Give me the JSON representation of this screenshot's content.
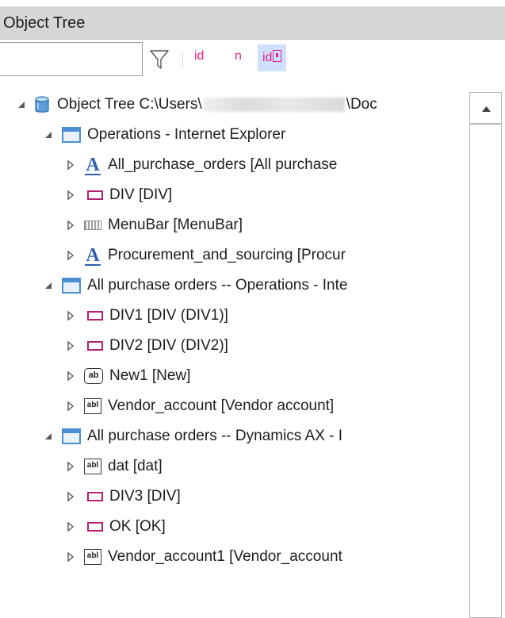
{
  "panel": {
    "title": "Object Tree"
  },
  "toolbar": {
    "search_value": "",
    "filter_icon": "filter-icon",
    "id_label": "id",
    "n_label": "n",
    "id_alt_label": "id"
  },
  "tree": {
    "root": {
      "label_start": "Object Tree C:\\Users\\",
      "label_end": "\\Doc"
    },
    "nodes": [
      {
        "label": "Operations - Internet Explorer",
        "icon": "window-icon"
      },
      {
        "label": "All_purchase_orders [All purchase",
        "icon": "anchor-a-icon"
      },
      {
        "label": "DIV [DIV]",
        "icon": "div-icon"
      },
      {
        "label": "MenuBar [MenuBar]",
        "icon": "menubar-icon"
      },
      {
        "label": "Procurement_and_sourcing [Procur",
        "icon": "anchor-a-icon"
      },
      {
        "label": "All purchase orders -- Operations - Inte",
        "icon": "window-icon"
      },
      {
        "label": "DIV1 [DIV (DIV1)]",
        "icon": "div-icon"
      },
      {
        "label": "DIV2 [DIV (DIV2)]",
        "icon": "div-icon"
      },
      {
        "label": "New1 [New]",
        "icon": "button-ab-icon"
      },
      {
        "label": "Vendor_account [Vendor account]",
        "icon": "textbox-abl-icon"
      },
      {
        "label": "All purchase orders -- Dynamics AX - I",
        "icon": "window-icon"
      },
      {
        "label": "dat [dat]",
        "icon": "textbox-abl-icon"
      },
      {
        "label": "DIV3 [DIV]",
        "icon": "div-icon"
      },
      {
        "label": "OK [OK]",
        "icon": "div-icon"
      },
      {
        "label": "Vendor_account1 [Vendor_account",
        "icon": "textbox-abl-icon"
      }
    ]
  },
  "icon_text": {
    "ab": "ab",
    "abl": "abl",
    "a": "A"
  },
  "colors": {
    "accent": "#4b8ed1",
    "pink": "#e0218a",
    "div_icon": "#b3226f",
    "title_bar": "#d6d6d6"
  }
}
